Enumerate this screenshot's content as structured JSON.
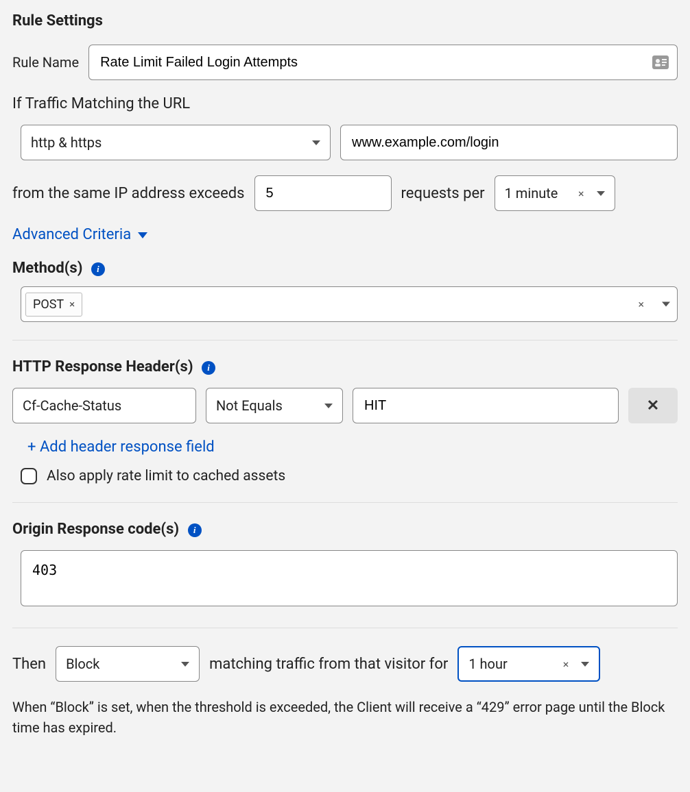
{
  "section_title": "Rule Settings",
  "rule_name": {
    "label": "Rule Name",
    "value": "Rate Limit Failed Login Attempts"
  },
  "traffic": {
    "label": "If Traffic Matching the URL",
    "scheme": "http & https",
    "url": "www.example.com/login"
  },
  "threshold": {
    "prefix": "from the same IP address exceeds",
    "count": "5",
    "mid": "requests per",
    "period": "1 minute"
  },
  "advanced_link": "Advanced Criteria",
  "methods": {
    "label": "Method(s)",
    "chips": [
      "POST"
    ]
  },
  "headers": {
    "label": "HTTP Response Header(s)",
    "rows": [
      {
        "name": "Cf-Cache-Status",
        "op": "Not Equals",
        "value": "HIT"
      }
    ],
    "add_link": "+ Add header response field",
    "cached_checkbox_label": "Also apply rate limit to cached assets",
    "cached_checked": false
  },
  "origin": {
    "label": "Origin Response code(s)",
    "value": "403"
  },
  "action": {
    "then_label": "Then",
    "action": "Block",
    "mid": "matching traffic from that visitor for",
    "duration": "1 hour",
    "help": "When “Block” is set, when the threshold is exceeded, the Client will receive a “429” error page until the Block time has expired."
  }
}
